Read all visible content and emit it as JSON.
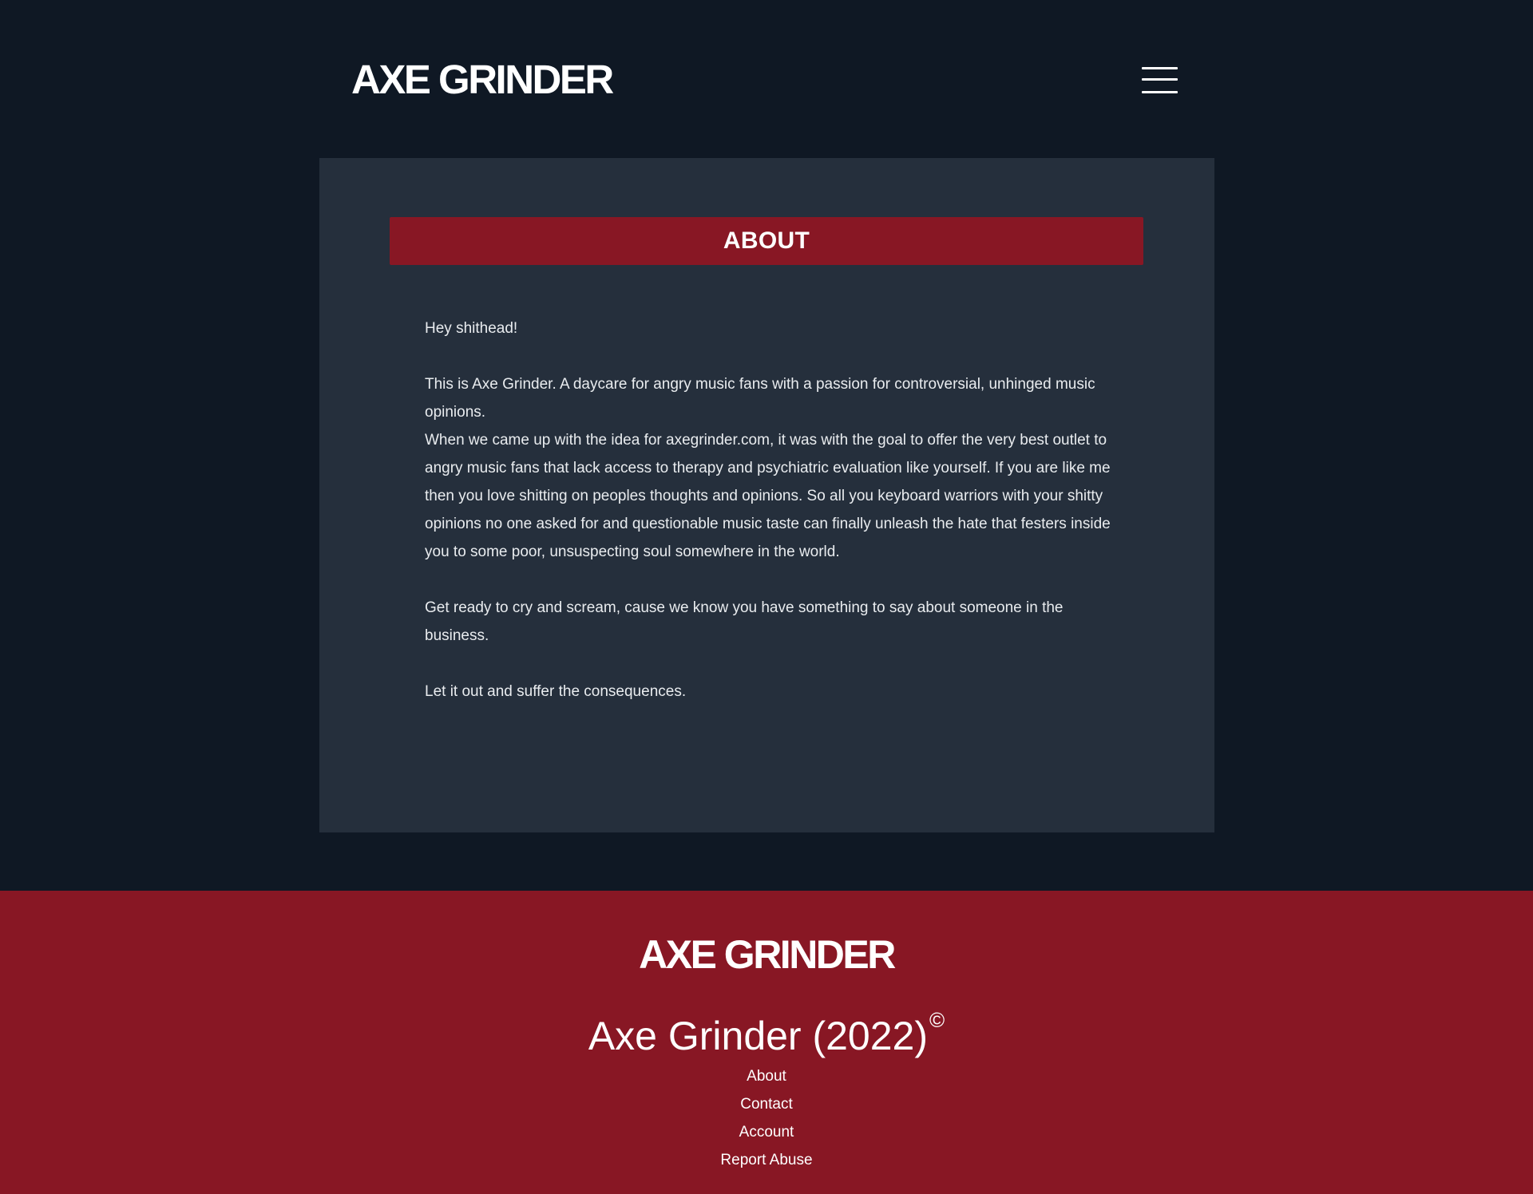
{
  "header": {
    "logo": "AXE GRINDER",
    "menu_icon": "hamburger-menu-icon"
  },
  "about": {
    "title": "ABOUT",
    "greeting": "Hey shithead!",
    "paragraph_1": "This is Axe Grinder. A daycare for angry music fans with a passion for controversial, unhinged music opinions.",
    "paragraph_2": "When we came up with the idea for axegrinder.com, it was with the goal to offer the very best outlet to angry music fans that lack access to therapy and psychiatric evaluation like yourself. If you are like me then you love shitting on peoples thoughts and opinions. So all you keyboard warriors with your shitty opinions no one asked for and questionable music taste can finally unleash the hate that festers inside you to some poor, unsuspecting soul somewhere in the world.",
    "paragraph_3": "Get ready to cry and scream, cause we know you have something to say about someone in the business.",
    "paragraph_4": "Let it out and suffer the consequences."
  },
  "footer": {
    "logo": "AXE GRINDER",
    "copyright_text": "Axe Grinder (2022)",
    "copyright_symbol": "©",
    "links": [
      "About",
      "Contact",
      "Account",
      "Report Abuse"
    ]
  },
  "colors": {
    "page_background": "#0f1824",
    "card_background": "#252f3c",
    "accent_red": "#881724",
    "text": "#ffffff"
  }
}
